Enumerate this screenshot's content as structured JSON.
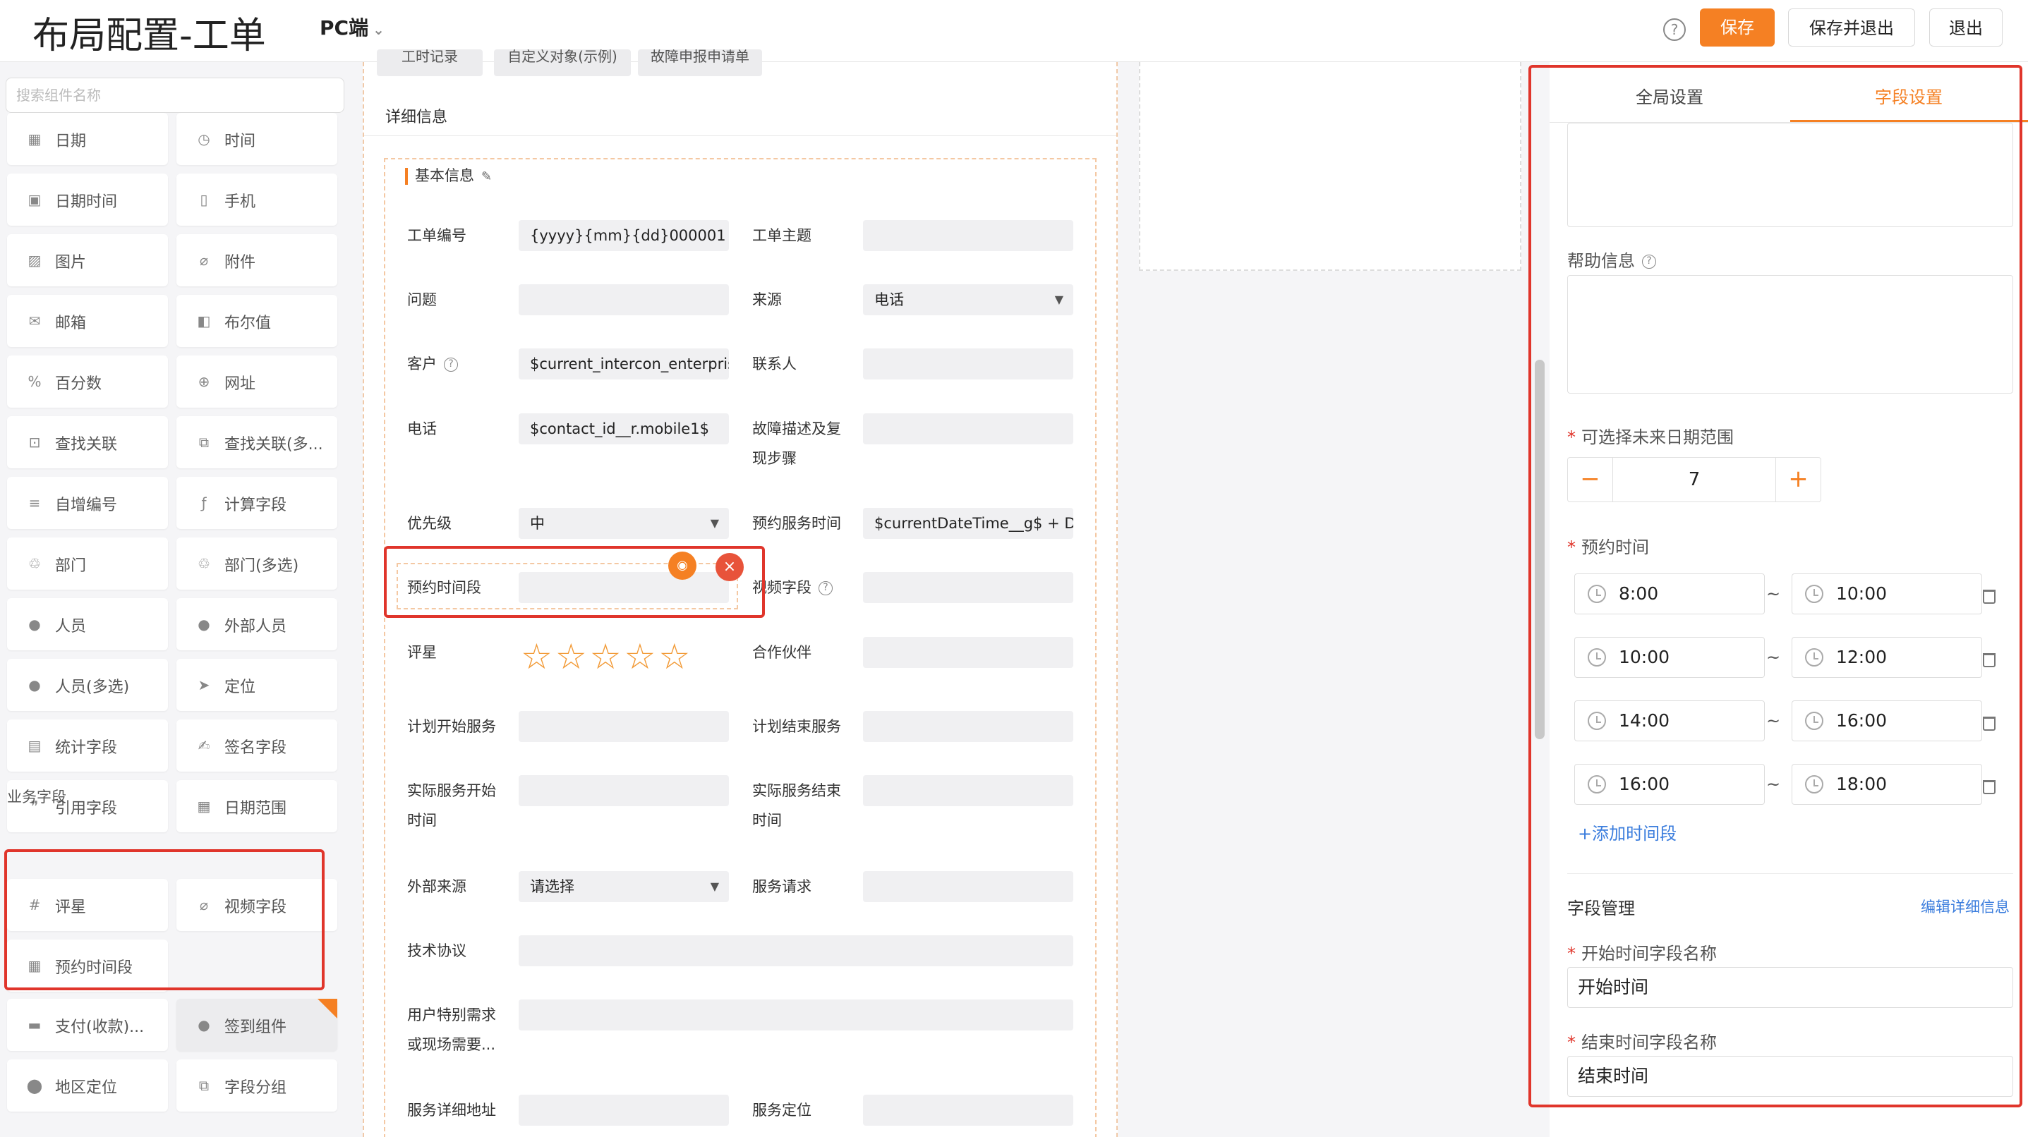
{
  "header": {
    "title": "布局配置-工单",
    "platform": "PC端",
    "save_label": "保存",
    "save_exit_label": "保存并退出",
    "exit_label": "退出",
    "accent_color": "#f58023"
  },
  "palette": {
    "search_placeholder": "搜索组件名称",
    "items": [
      {
        "label": "日期",
        "icon": "calendar-icon"
      },
      {
        "label": "时间",
        "icon": "clock-icon"
      },
      {
        "label": "日期时间",
        "icon": "datetime-icon"
      },
      {
        "label": "手机",
        "icon": "phone-icon"
      },
      {
        "label": "图片",
        "icon": "image-icon"
      },
      {
        "label": "附件",
        "icon": "paperclip-icon"
      },
      {
        "label": "邮箱",
        "icon": "mail-icon"
      },
      {
        "label": "布尔值",
        "icon": "boolean-icon"
      },
      {
        "label": "百分数",
        "icon": "percent-icon"
      },
      {
        "label": "网址",
        "icon": "globe-icon"
      },
      {
        "label": "查找关联",
        "icon": "lookup-icon"
      },
      {
        "label": "查找关联(多...",
        "icon": "lookup-multi-icon"
      },
      {
        "label": "自增编号",
        "icon": "autonumber-icon"
      },
      {
        "label": "计算字段",
        "icon": "formula-icon"
      },
      {
        "label": "部门",
        "icon": "department-icon"
      },
      {
        "label": "部门(多选)",
        "icon": "department-multi-icon"
      },
      {
        "label": "人员",
        "icon": "person-icon"
      },
      {
        "label": "外部人员",
        "icon": "external-person-icon"
      },
      {
        "label": "人员(多选)",
        "icon": "people-icon"
      },
      {
        "label": "定位",
        "icon": "location-arrow-icon"
      },
      {
        "label": "统计字段",
        "icon": "statistics-icon"
      },
      {
        "label": "签名字段",
        "icon": "signature-icon"
      },
      {
        "label": "引用字段",
        "icon": "quote-icon"
      },
      {
        "label": "日期范围",
        "icon": "date-range-icon"
      }
    ],
    "business_section_label": "业务字段",
    "business_items": [
      {
        "label": "评星",
        "icon": "hash-icon"
      },
      {
        "label": "视频字段",
        "icon": "paperclip-icon"
      },
      {
        "label": "预约时间段",
        "icon": "calendar-icon"
      }
    ],
    "extra_items": [
      {
        "label": "支付(收款)...",
        "icon": "payment-icon"
      },
      {
        "label": "签到组件",
        "icon": "checkin-icon"
      },
      {
        "label": "地区定位",
        "icon": "map-pin-icon"
      },
      {
        "label": "字段分组",
        "icon": "group-icon"
      }
    ]
  },
  "canvas": {
    "top_tabs": [
      "工时记录",
      "自定义对象(示例)",
      "故障申报申请单"
    ],
    "detail_title": "详细信息",
    "group_title": "基本信息",
    "fields": {
      "ticket_no": {
        "label": "工单编号",
        "value": "{yyyy}{mm}{dd}000001"
      },
      "subject": {
        "label": "工单主题",
        "value": ""
      },
      "issue": {
        "label": "问题",
        "value": ""
      },
      "source": {
        "label": "来源",
        "value": "电话"
      },
      "customer": {
        "label": "客户",
        "value": "$current_intercon_enterprise_"
      },
      "contact": {
        "label": "联系人",
        "value": ""
      },
      "phone": {
        "label": "电话",
        "value": "$contact_id__r.mobile1$"
      },
      "fault_line1": "故障描述及复",
      "fault_line2": "现步骤",
      "priority": {
        "label": "优先级",
        "value": "中"
      },
      "appointment_time": {
        "label": "预约服务时间",
        "value": "$currentDateTime__g$ + DAY"
      },
      "appointment_slot": {
        "label": "预约时间段",
        "value": ""
      },
      "video": {
        "label": "视频字段",
        "value": ""
      },
      "rating": {
        "label": "评星",
        "stars": 5,
        "filled": 0
      },
      "partner": {
        "label": "合作伙伴",
        "value": ""
      },
      "plan_start": {
        "label": "计划开始服务",
        "value": ""
      },
      "plan_end": {
        "label": "计划结束服务",
        "value": ""
      },
      "actual_start_line1": "实际服务开始",
      "actual_start_line2": "时间",
      "actual_end_line1": "实际服务结束",
      "actual_end_line2": "时间",
      "external_source": {
        "label": "外部来源",
        "value": "请选择"
      },
      "service_request": {
        "label": "服务请求",
        "value": ""
      },
      "tech_agreement": {
        "label": "技术协议",
        "value": ""
      },
      "user_req_line1": "用户特别需求",
      "user_req_line2": "或现场需要...",
      "service_address": {
        "label": "服务详细地址",
        "value": ""
      },
      "service_location": {
        "label": "服务定位",
        "value": ""
      }
    }
  },
  "properties": {
    "tab_global": "全局设置",
    "tab_field": "字段设置",
    "help_label": "帮助信息",
    "future_range_label": "可选择未来日期范围",
    "future_range_value": "7",
    "appointment_label": "预约时间",
    "time_slots": [
      {
        "start": "8:00",
        "end": "10:00"
      },
      {
        "start": "10:00",
        "end": "12:00"
      },
      {
        "start": "14:00",
        "end": "16:00"
      },
      {
        "start": "16:00",
        "end": "18:00"
      }
    ],
    "tilde": "~",
    "add_slot_label": "+添加时间段",
    "field_manage_label": "字段管理",
    "edit_detail_link": "编辑详细信息",
    "start_field_label": "开始时间字段名称",
    "start_field_value": "开始时间",
    "end_field_label": "结束时间字段名称",
    "end_field_value": "结束时间"
  }
}
